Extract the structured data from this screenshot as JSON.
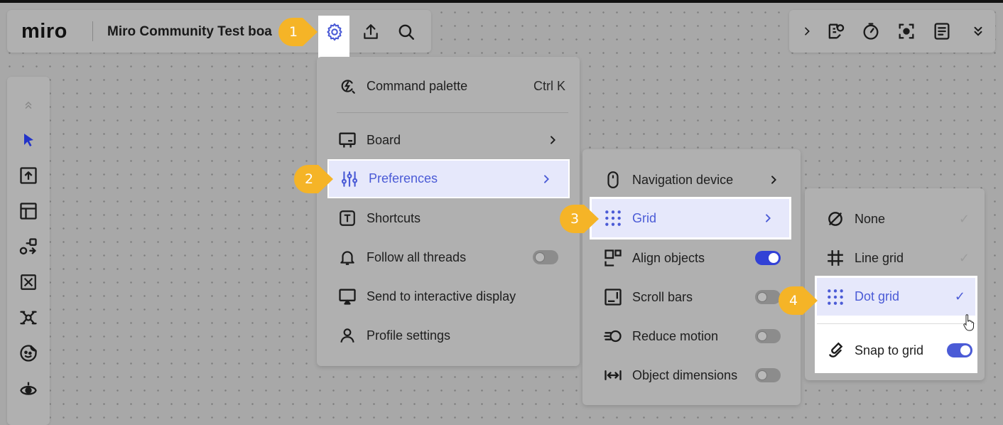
{
  "app": {
    "logo": "miro",
    "board_title": "Miro Community Test boa"
  },
  "top_left_icons": [
    "settings-gear-icon",
    "export-upload-icon",
    "search-icon"
  ],
  "top_right_icons": [
    "expand-chevron-icon",
    "board-activity-icon",
    "timer-icon",
    "focus-mode-icon",
    "notes-icon",
    "collapse-down-icon"
  ],
  "left_toolbar_icons": [
    "collapse-up-icon",
    "select-cursor-icon",
    "upload-icon",
    "templates-icon",
    "diagram-shapes-icon",
    "frame-icon",
    "mind-map-icon",
    "sticker-icon",
    "more-apps-icon"
  ],
  "main_menu": {
    "command_palette": {
      "label": "Command palette",
      "shortcut": "Ctrl K"
    },
    "board": {
      "label": "Board"
    },
    "preferences": {
      "label": "Preferences"
    },
    "shortcuts": {
      "label": "Shortcuts"
    },
    "follow_threads": {
      "label": "Follow all threads",
      "enabled": false
    },
    "send_display": {
      "label": "Send to interactive display"
    },
    "profile": {
      "label": "Profile settings"
    }
  },
  "preferences_menu": {
    "navigation_device": {
      "label": "Navigation device"
    },
    "grid": {
      "label": "Grid"
    },
    "align_objects": {
      "label": "Align objects",
      "enabled": true
    },
    "scroll_bars": {
      "label": "Scroll bars",
      "enabled": false
    },
    "reduce_motion": {
      "label": "Reduce motion",
      "enabled": false
    },
    "object_dimensions": {
      "label": "Object dimensions",
      "enabled": false
    }
  },
  "grid_menu": {
    "none": {
      "label": "None",
      "check": "✓"
    },
    "line_grid": {
      "label": "Line grid",
      "check": "✓"
    },
    "dot_grid": {
      "label": "Dot grid",
      "check": "✓",
      "selected": true
    },
    "snap_to_grid": {
      "label": "Snap to grid",
      "enabled": true
    }
  },
  "steps": [
    "1",
    "2",
    "3",
    "4"
  ],
  "colors": {
    "accent": "#4b5bd6",
    "toggle_on": "#3241d6",
    "badge": "#f5b427",
    "highlight_row": "#e6e8fb"
  }
}
